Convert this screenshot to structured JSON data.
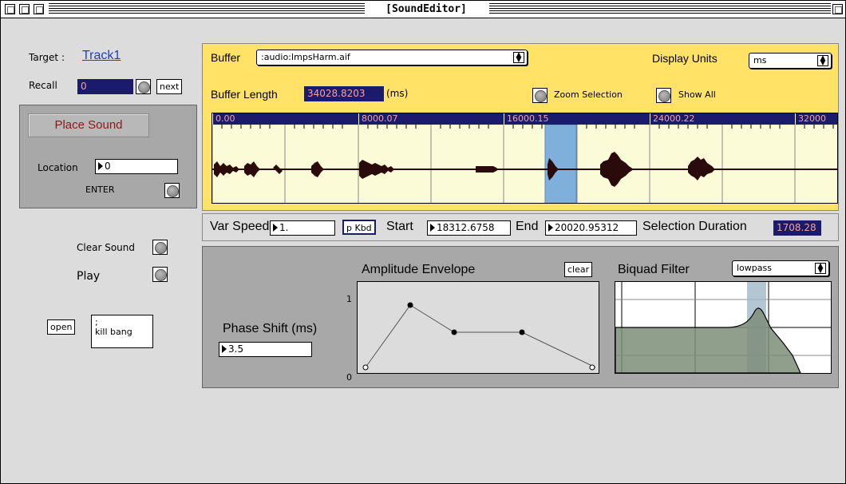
{
  "window": {
    "title": "[SoundEditor]"
  },
  "left": {
    "target_label": "Target :",
    "target_value": "Track1",
    "recall_label": "Recall",
    "recall_value": "0",
    "next_label": "next",
    "place_sound_label": "Place Sound",
    "location_label": "Location",
    "location_value": "0",
    "enter_label": "ENTER",
    "clear_sound_label": "Clear Sound",
    "play_label": "Play",
    "open_label": "open",
    "message_line1": ";",
    "message_line2": "kill bang"
  },
  "buffer": {
    "buffer_label": "Buffer",
    "buffer_file": ":audio:ImpsHarm.aif",
    "display_units_label": "Display Units",
    "display_units_value": "ms",
    "length_label": "Buffer Length",
    "length_value": "34028.8203",
    "length_unit": "(ms)",
    "zoom_selection_label": "Zoom Selection",
    "show_all_label": "Show All",
    "ruler_ticks": [
      "0.00",
      "8000.07",
      "16000.15",
      "24000.22",
      "32000"
    ]
  },
  "speed": {
    "var_speed_label": "Var Speed",
    "var_speed_value": "1.",
    "pkbd_label": "p Kbd",
    "start_label": "Start",
    "start_value": "18312.6758",
    "end_label": "End",
    "end_value": "20020.95312",
    "sel_duration_label": "Selection Duration",
    "sel_duration_value": "1708.28"
  },
  "lower": {
    "phase_shift_label": "Phase Shift (ms)",
    "phase_shift_value": "3.5",
    "amp_env_title": "Amplitude Envelope",
    "clear_label": "clear",
    "amp_y_max": "1",
    "amp_y_min": "0",
    "biquad_title": "Biquad Filter",
    "filter_type": "lowpass"
  },
  "colors": {
    "buffer_bg": "#ffe266",
    "selection": "#7fb0dc",
    "ruler_bg": "#1b1b6b",
    "ruler_text": "#f4a0a0",
    "dark_field": "#1b1b6b"
  }
}
